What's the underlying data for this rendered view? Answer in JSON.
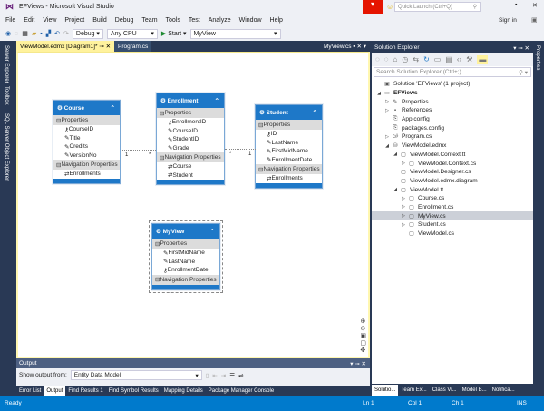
{
  "window": {
    "title": "EFViews - Microsoft Visual Studio",
    "quick_launch_placeholder": "Quick Launch (Ctrl+Q)",
    "sign_in": "Sign in"
  },
  "menu": [
    "File",
    "Edit",
    "View",
    "Project",
    "Build",
    "Debug",
    "Team",
    "Tools",
    "Test",
    "Analyze",
    "Window",
    "Help"
  ],
  "toolbar": {
    "configuration": "Debug",
    "platform": "Any CPU",
    "start": "Start",
    "startup_item": "MyView"
  },
  "left_tabs": [
    "Server Explorer",
    "Toolbox",
    "SQL Server Object Explorer"
  ],
  "right_tabs": [
    "Properties"
  ],
  "doc_tabs": [
    {
      "label": "ViewModel.edmx [Diagram1]*",
      "active": true
    },
    {
      "label": "Program.cs",
      "active": false
    }
  ],
  "preview_tab": "MyView.cs",
  "entities": [
    {
      "name": "Course",
      "properties": [
        {
          "label": "CourseID",
          "key": true
        },
        {
          "label": "Title"
        },
        {
          "label": "Credits"
        },
        {
          "label": "VersionNo"
        }
      ],
      "nav_label": "Navigation Properties",
      "props_label": "Properties",
      "navigation": [
        "Enrollments"
      ]
    },
    {
      "name": "Enrollment",
      "properties": [
        {
          "label": "EnrollmentID",
          "key": true
        },
        {
          "label": "CourseID"
        },
        {
          "label": "StudentID"
        },
        {
          "label": "Grade"
        }
      ],
      "nav_label": "Navigation Properties",
      "props_label": "Properties",
      "navigation": [
        "Course",
        "Student"
      ]
    },
    {
      "name": "Student",
      "properties": [
        {
          "label": "ID",
          "key": true
        },
        {
          "label": "LastName"
        },
        {
          "label": "FirstMidName"
        },
        {
          "label": "EnrollmentDate"
        }
      ],
      "nav_label": "Navigation Properties",
      "props_label": "Properties",
      "navigation": [
        "Enrollments"
      ]
    },
    {
      "name": "MyView",
      "properties": [
        {
          "label": "FirstMidName"
        },
        {
          "label": "LastName"
        },
        {
          "label": "EnrollmentDate",
          "key": true
        }
      ],
      "nav_label": "Navigation Properties",
      "props_label": "Properties",
      "navigation": [],
      "selected": true
    }
  ],
  "associations": [
    {
      "left": "1",
      "right": "*"
    },
    {
      "left": "*",
      "right": "1"
    }
  ],
  "solution_explorer": {
    "title": "Solution Explorer",
    "search_placeholder": "Search Solution Explorer (Ctrl+;)",
    "items": [
      {
        "label": "Solution 'EFViews' (1 project)",
        "level": 0,
        "expander": "",
        "icon": "solution-icon"
      },
      {
        "label": "EFViews",
        "level": 0,
        "expander": "open",
        "icon": "project-icon",
        "bold": true
      },
      {
        "label": "Properties",
        "level": 1,
        "expander": "closed",
        "icon": "wrench-icon"
      },
      {
        "label": "References",
        "level": 1,
        "expander": "closed",
        "icon": "references-icon"
      },
      {
        "label": "App.config",
        "level": 1,
        "expander": "",
        "icon": "config-icon"
      },
      {
        "label": "packages.config",
        "level": 1,
        "expander": "",
        "icon": "config-icon"
      },
      {
        "label": "Program.cs",
        "level": 1,
        "expander": "closed",
        "icon": "csharp-icon"
      },
      {
        "label": "ViewModel.edmx",
        "level": 1,
        "expander": "open",
        "icon": "edmx-icon"
      },
      {
        "label": "ViewModel.Context.tt",
        "level": 2,
        "expander": "open",
        "icon": "file-icon"
      },
      {
        "label": "ViewModel.Context.cs",
        "level": 3,
        "expander": "closed",
        "icon": "file-icon"
      },
      {
        "label": "ViewModel.Designer.cs",
        "level": 2,
        "expander": "",
        "icon": "file-icon"
      },
      {
        "label": "ViewModel.edmx.diagram",
        "level": 2,
        "expander": "",
        "icon": "file-icon"
      },
      {
        "label": "ViewModel.tt",
        "level": 2,
        "expander": "open",
        "icon": "file-icon"
      },
      {
        "label": "Course.cs",
        "level": 3,
        "expander": "closed",
        "icon": "file-icon"
      },
      {
        "label": "Enrollment.cs",
        "level": 3,
        "expander": "closed",
        "icon": "file-icon"
      },
      {
        "label": "MyView.cs",
        "level": 3,
        "expander": "closed",
        "icon": "file-icon",
        "selected": true
      },
      {
        "label": "Student.cs",
        "level": 3,
        "expander": "closed",
        "icon": "file-icon"
      },
      {
        "label": "ViewModel.cs",
        "level": 3,
        "expander": "",
        "icon": "file-icon"
      }
    ]
  },
  "output": {
    "title": "Output",
    "show_from_label": "Show output from:",
    "source": "Entity Data Model"
  },
  "bottom_tabs": [
    {
      "label": "Error List"
    },
    {
      "label": "Output",
      "active": true
    },
    {
      "label": "Find Results 1"
    },
    {
      "label": "Find Symbol Results"
    },
    {
      "label": "Mapping Details"
    },
    {
      "label": "Package Manager Console"
    }
  ],
  "solution_tabs": [
    {
      "label": "Solutio...",
      "active": true
    },
    {
      "label": "Team Ex..."
    },
    {
      "label": "Class Vi..."
    },
    {
      "label": "Model B..."
    },
    {
      "label": "Notifica..."
    }
  ],
  "status": {
    "text": "Ready",
    "ln": "Ln 1",
    "col": "Col 1",
    "ch": "Ch 1",
    "mode": "INS"
  },
  "colors": {
    "frame": "#293955",
    "entity_header": "#1e78c8",
    "status_bar": "#007acc",
    "notification": "#e51400"
  }
}
